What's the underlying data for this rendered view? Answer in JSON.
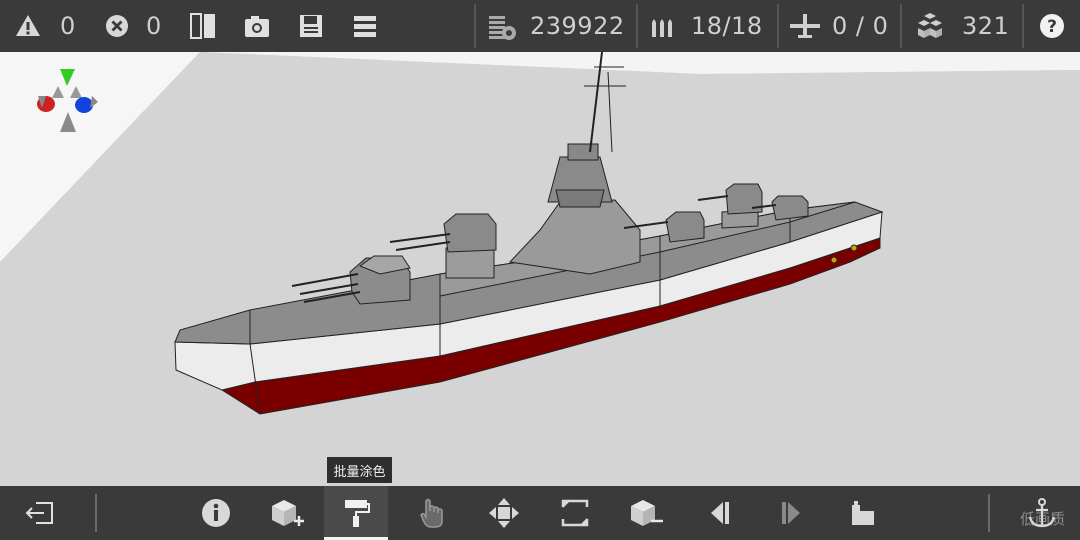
{
  "topbar": {
    "warnings": "0",
    "errors": "0",
    "mass": "239922",
    "ammo": "18/18",
    "aircraft": "0 / 0",
    "parts": "321"
  },
  "tooltip": "批量涂色",
  "watermark": "低画质",
  "colors": {
    "hull_red": "#7a0000",
    "hull_white": "#ececec",
    "deck_gray": "#8e8e8e",
    "bar_bg": "#3a3a3a"
  },
  "icons": {
    "top": [
      "warning-icon",
      "error-icon",
      "split-view-icon",
      "camera-icon",
      "save-icon",
      "menu-icon",
      "mass-icon",
      "ammo-icon",
      "aircraft-icon",
      "parts-icon",
      "help-icon"
    ],
    "bottom": [
      "exit-icon",
      "info-icon",
      "add-part-icon",
      "paint-roller-icon",
      "hand-icon",
      "move-icon",
      "scale-icon",
      "remove-part-icon",
      "undo-icon",
      "redo-icon",
      "factory-icon",
      "anchor-icon"
    ]
  }
}
